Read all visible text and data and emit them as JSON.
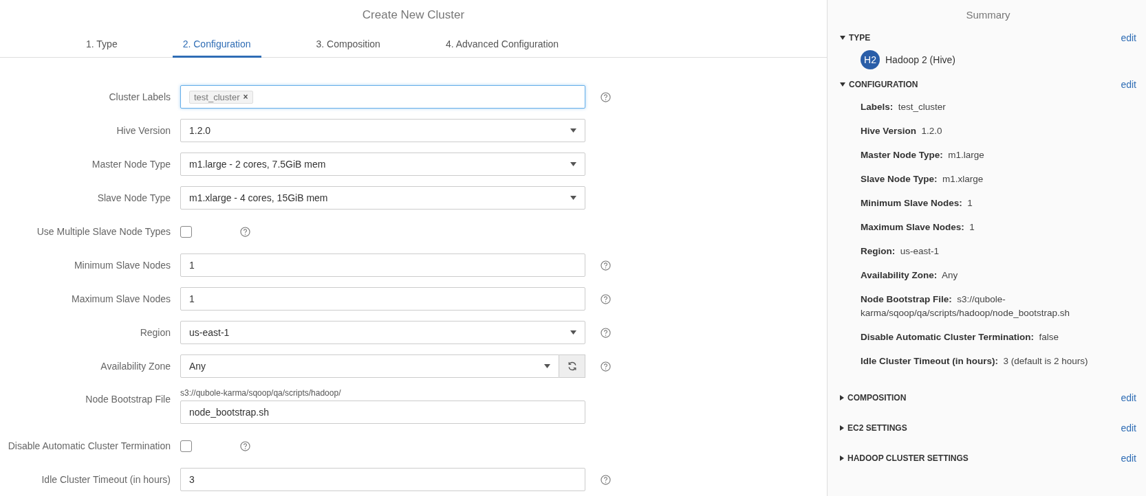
{
  "main": {
    "title": "Create New Cluster",
    "tabs": [
      {
        "label": "1. Type",
        "selected": false
      },
      {
        "label": "2. Configuration",
        "selected": true
      },
      {
        "label": "3. Composition",
        "selected": false
      },
      {
        "label": "4. Advanced Configuration",
        "selected": false
      }
    ],
    "fields": [
      {
        "kind": "tags",
        "label": "Cluster Labels",
        "tags": [
          "test_cluster"
        ],
        "remove": "×",
        "focused": true,
        "help": true
      },
      {
        "kind": "select",
        "label": "Hive Version",
        "value": "1.2.0",
        "help": false
      },
      {
        "kind": "select",
        "label": "Master Node Type",
        "value": "m1.large - 2 cores, 7.5GiB mem",
        "help": false
      },
      {
        "kind": "select",
        "label": "Slave Node Type",
        "value": "m1.xlarge - 4 cores, 15GiB mem",
        "help": false
      },
      {
        "kind": "checkbox",
        "label": "Use Multiple Slave Node Types",
        "checked": false,
        "help": true
      },
      {
        "kind": "text",
        "label": "Minimum Slave Nodes",
        "value": "1",
        "help": true
      },
      {
        "kind": "text",
        "label": "Maximum Slave Nodes",
        "value": "1",
        "help": true
      },
      {
        "kind": "select",
        "label": "Region",
        "value": "us-east-1",
        "help": true
      },
      {
        "kind": "select_refresh",
        "label": "Availability Zone",
        "value": "Any",
        "help": true
      },
      {
        "kind": "prefixed",
        "label": "Node Bootstrap File",
        "prefix": "s3://qubole-karma/sqoop/qa/scripts/hadoop/",
        "value": "node_bootstrap.sh",
        "help": false
      },
      {
        "kind": "checkbox",
        "label": "Disable Automatic Cluster Termination",
        "checked": false,
        "help": true
      },
      {
        "kind": "text",
        "label": "Idle Cluster Timeout (in hours)",
        "value": "3",
        "help": true
      }
    ]
  },
  "summary": {
    "title": "Summary",
    "sections": [
      {
        "title": "TYPE",
        "expanded": true,
        "edit": "edit",
        "badge": "H2",
        "type_name": "Hadoop 2 (Hive)"
      },
      {
        "title": "CONFIGURATION",
        "expanded": true,
        "edit": "edit",
        "items": [
          {
            "label": "Labels:",
            "value": "test_cluster"
          },
          {
            "label": "Hive Version",
            "value": "1.2.0"
          },
          {
            "label": "Master Node Type:",
            "value": "m1.large"
          },
          {
            "label": "Slave Node Type:",
            "value": "m1.xlarge"
          },
          {
            "label": "Minimum Slave Nodes:",
            "value": "1"
          },
          {
            "label": "Maximum Slave Nodes:",
            "value": "1"
          },
          {
            "label": "Region:",
            "value": "us-east-1"
          },
          {
            "label": "Availability Zone:",
            "value": "Any"
          },
          {
            "label": "Node Bootstrap File:",
            "value": "s3://qubole-karma/sqoop/qa/scripts/hadoop/node_bootstrap.sh"
          },
          {
            "label": "Disable Automatic Cluster Termination:",
            "value": "false"
          },
          {
            "label": "Idle Cluster Timeout (in hours):",
            "value": "3 (default is 2 hours)"
          }
        ]
      },
      {
        "title": "COMPOSITION",
        "expanded": false,
        "edit": "edit"
      },
      {
        "title": "EC2 SETTINGS",
        "expanded": false,
        "edit": "edit"
      },
      {
        "title": "HADOOP CLUSTER SETTINGS",
        "expanded": false,
        "edit": "edit"
      }
    ]
  }
}
